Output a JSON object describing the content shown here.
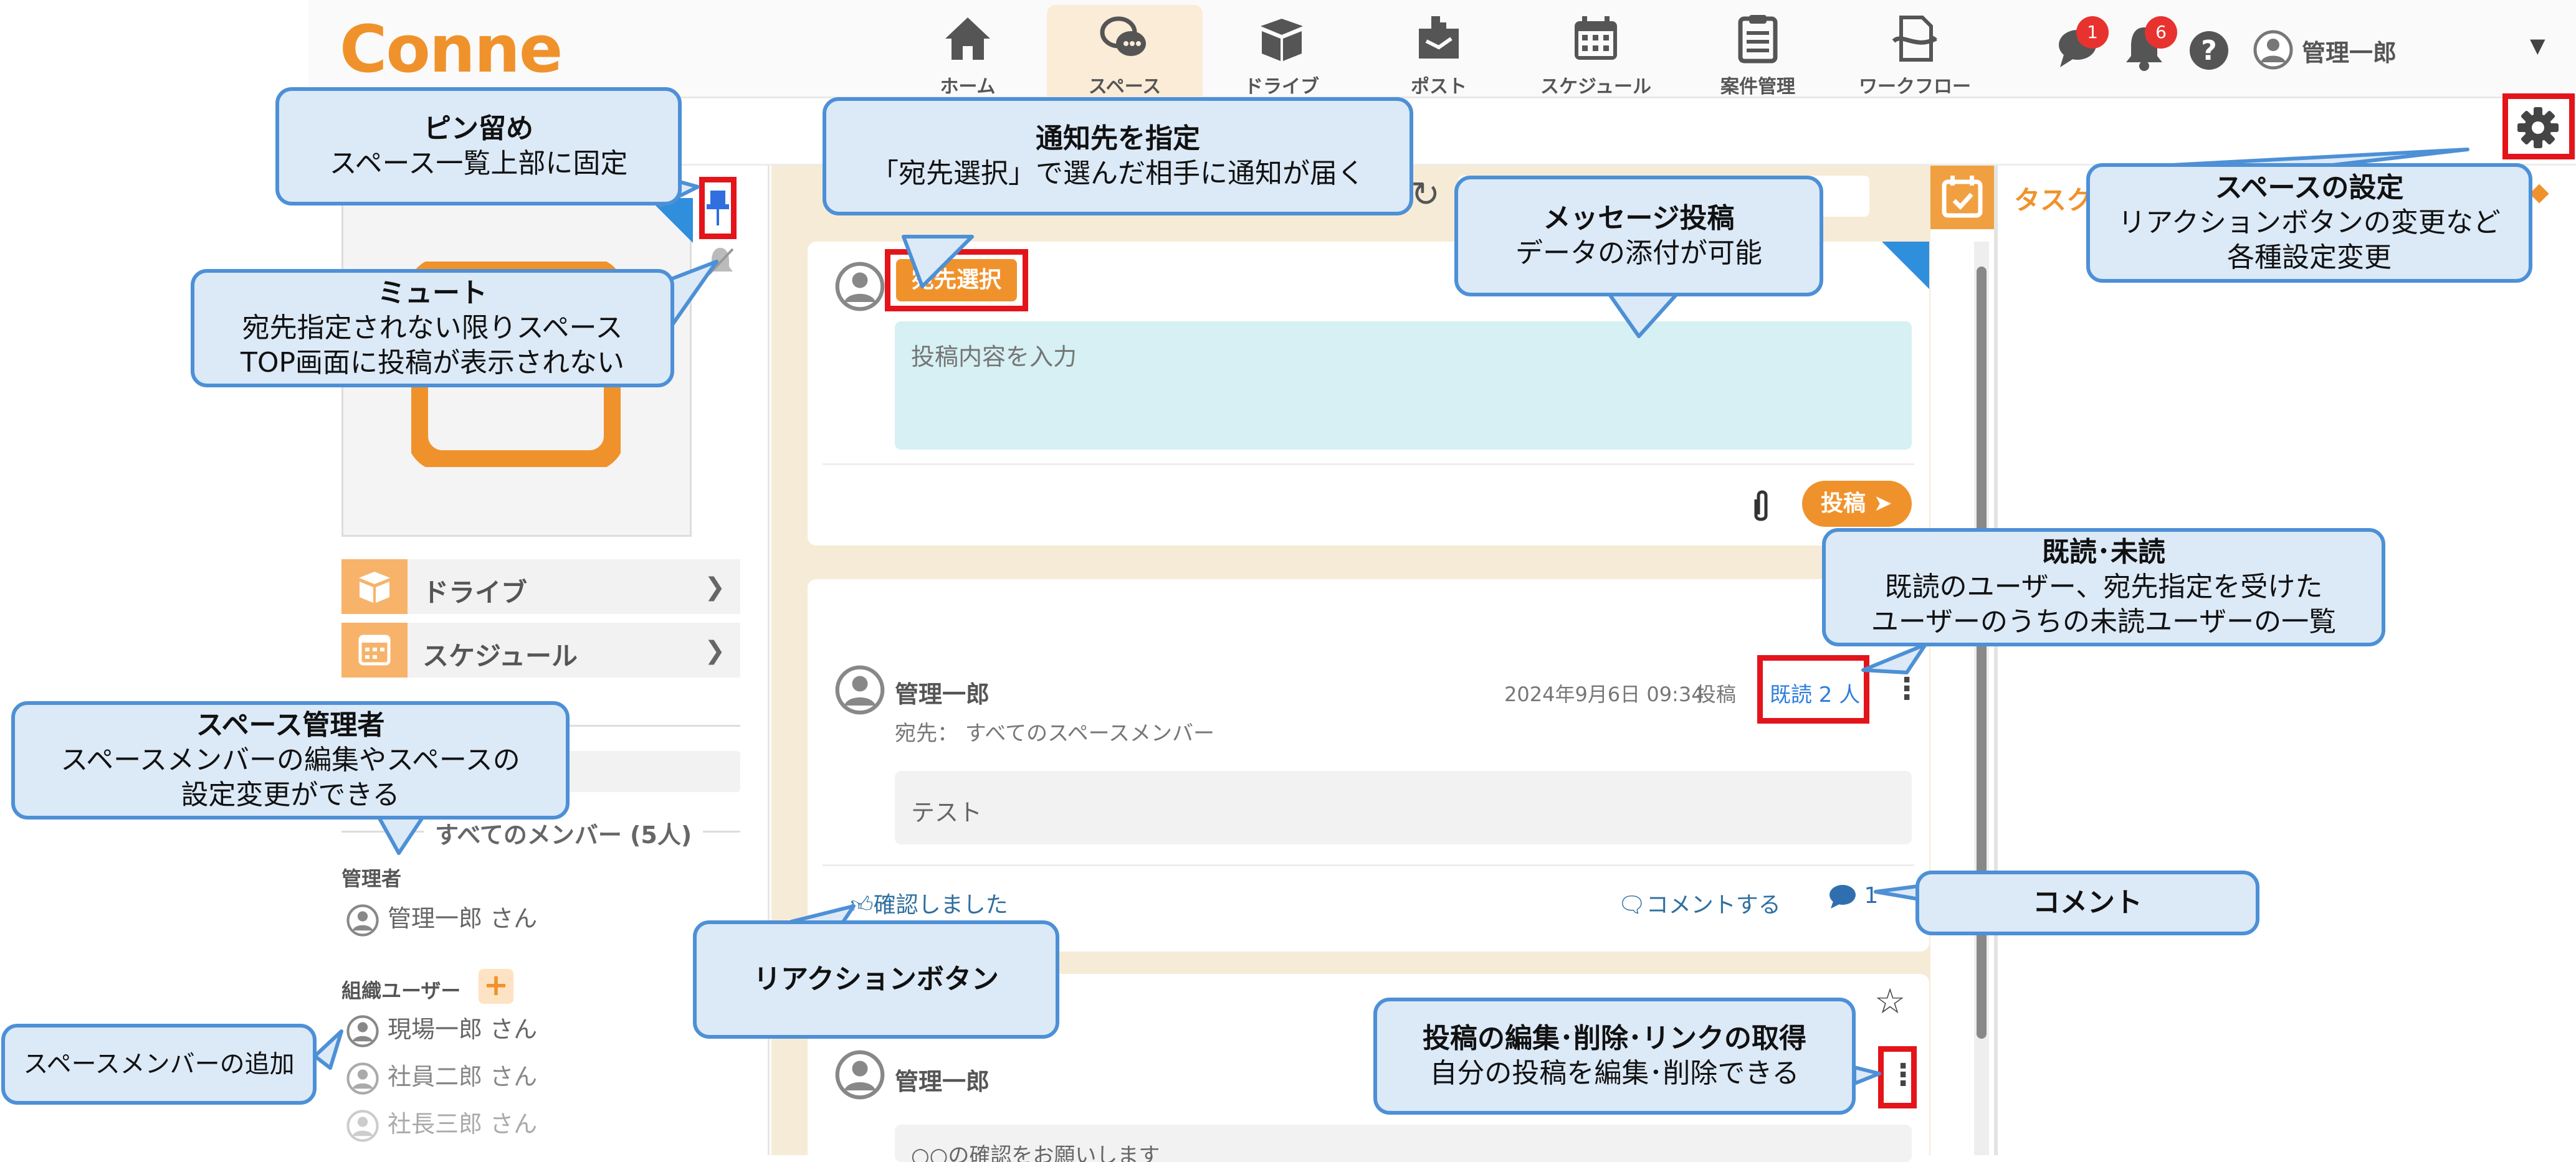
{
  "app": {
    "logo": "Conne"
  },
  "nav": {
    "items": [
      {
        "label": "ホーム",
        "icon": "home-icon"
      },
      {
        "label": "スペース",
        "icon": "space-chat-icon"
      },
      {
        "label": "ドライブ",
        "icon": "drive-box-icon"
      },
      {
        "label": "ポスト",
        "icon": "post-icon"
      },
      {
        "label": "スケジュール",
        "icon": "calendar-icon"
      },
      {
        "label": "案件管理",
        "icon": "clipboard-icon"
      },
      {
        "label": "ワークフロー",
        "icon": "workflow-icon"
      }
    ],
    "chat_badge": "1",
    "bell_badge": "6",
    "user_name": "管理一郎"
  },
  "sidebar": {
    "links": [
      {
        "label": "ドライブ",
        "icon": "drive-box-icon"
      },
      {
        "label": "スケジュール",
        "icon": "calendar-icon"
      }
    ],
    "members_header": "すべてのメンバー (5人)",
    "admin_label": "管理者",
    "admins": [
      "管理一郎 さん"
    ],
    "org_label": "組織ユーザー",
    "org_add": "+",
    "org_users": [
      "現場一郎 さん",
      "社員二郎 さん",
      "社長三郎 さん"
    ]
  },
  "composer": {
    "recipient_button": "宛先選択",
    "placeholder": "投稿内容を入力",
    "post_button": "投稿"
  },
  "post1": {
    "author": "管理一郎",
    "datetime": "2024年9月6日 09:34",
    "posted_label": "投稿",
    "read_label": "既読 2 人",
    "recipients": "宛先： すべてのスペースメンバー",
    "body": "テスト",
    "reaction": "確認しました",
    "comment_action": "コメントする",
    "comment_count": "1"
  },
  "post2": {
    "author": "管理一郎",
    "body_partial": "○○の確認をお願いします"
  },
  "right_panel": {
    "title": "タスク"
  },
  "callouts": {
    "pin": {
      "title": "ピン留め",
      "body": [
        "スペース一覧上部に固定"
      ]
    },
    "mute": {
      "title": "ミュート",
      "body": [
        "宛先指定されない限りスペース",
        "TOP画面に投稿が表示されない"
      ]
    },
    "notify": {
      "title": "通知先を指定",
      "body": [
        "「宛先選択」で選んだ相手に通知が届く"
      ]
    },
    "message": {
      "title": "メッセージ投稿",
      "body": [
        "データの添付が可能"
      ]
    },
    "settings": {
      "title": "スペースの設定",
      "body": [
        "リアクションボタンの変更など",
        "各種設定変更"
      ]
    },
    "read": {
      "title": "既読･未読",
      "body": [
        "既読のユーザー、宛先指定を受けた",
        "ユーザーのうちの未読ユーザーの一覧"
      ]
    },
    "admin": {
      "title": "スペース管理者",
      "body": [
        "スペースメンバーの編集やスペースの",
        "設定変更ができる"
      ]
    },
    "comment": {
      "title": "コメント"
    },
    "reaction": {
      "title": "リアクションボタン"
    },
    "edit": {
      "title": "投稿の編集･削除･リンクの取得",
      "body": [
        "自分の投稿を編集･削除できる"
      ]
    },
    "add_member": {
      "title": "スペースメンバーの追加"
    }
  },
  "colors": {
    "accent": "#f0922b",
    "callout_fill": "#dce9f7",
    "callout_border": "#4d90d6",
    "highlight": "#e3141a"
  }
}
